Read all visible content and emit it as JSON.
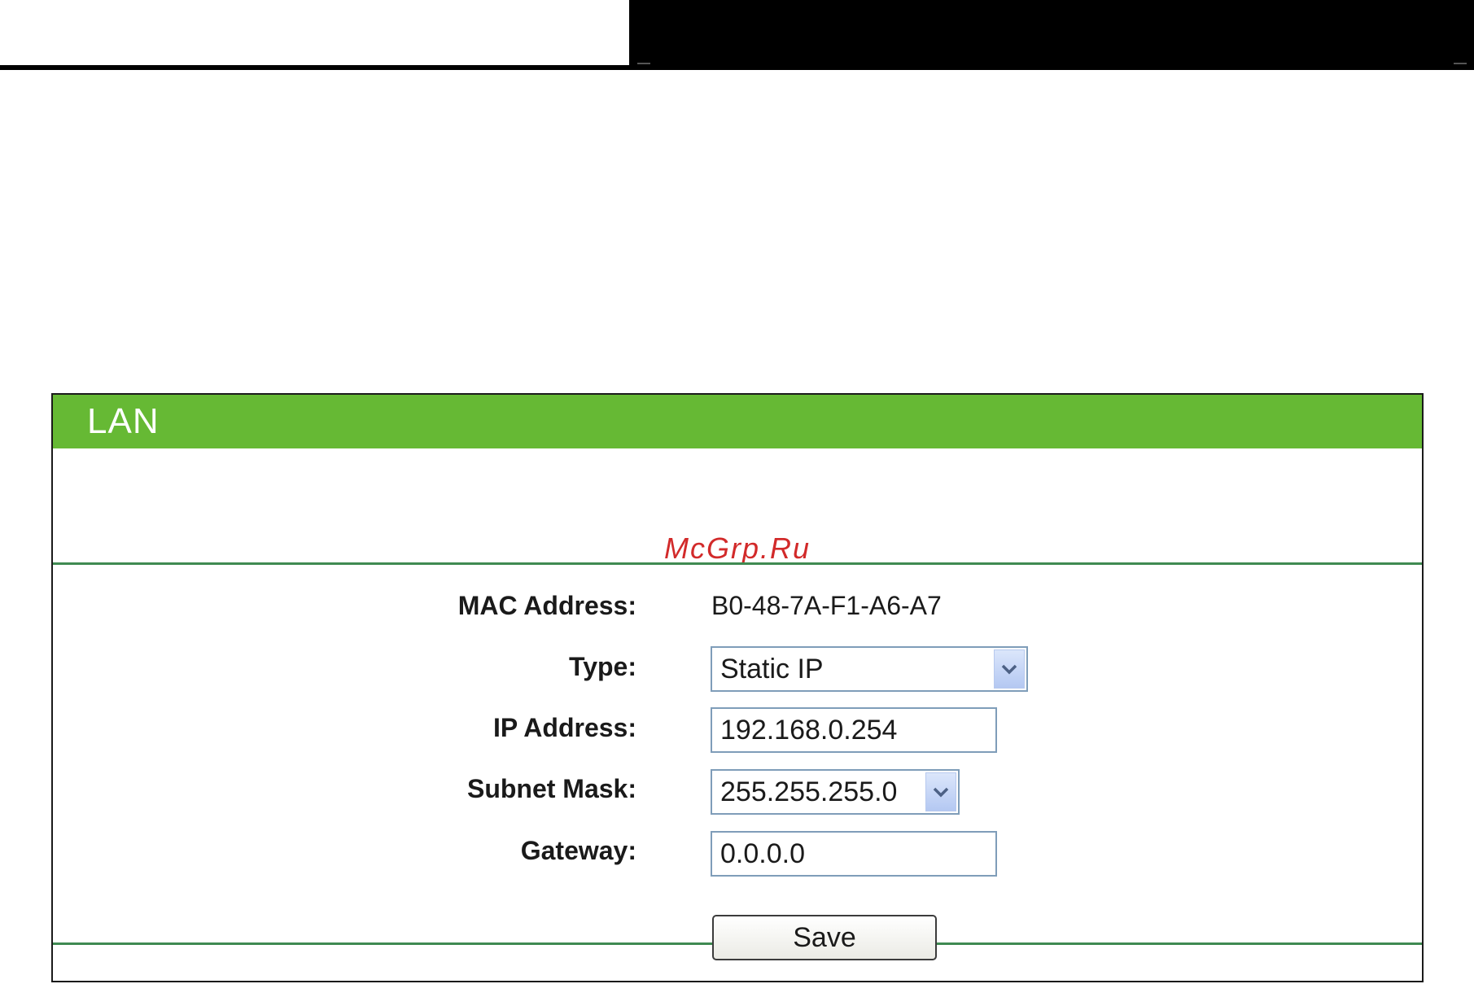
{
  "panel": {
    "title": "LAN",
    "watermark": "McGrp.Ru"
  },
  "form": {
    "mac": {
      "label": "MAC Address:",
      "value": "B0-48-7A-F1-A6-A7"
    },
    "type": {
      "label": "Type:",
      "value": "Static IP"
    },
    "ip": {
      "label": "IP Address:",
      "value": "192.168.0.254"
    },
    "subnet": {
      "label": "Subnet Mask:",
      "value": "255.255.255.0"
    },
    "gateway": {
      "label": "Gateway:",
      "value": "0.0.0.0"
    }
  },
  "actions": {
    "save_label": "Save"
  },
  "colors": {
    "header_green": "#66b934",
    "divider_green": "#3f8a52",
    "watermark_red": "#d22a2a"
  },
  "icons": {
    "dropdown": "chevron-down-icon"
  }
}
